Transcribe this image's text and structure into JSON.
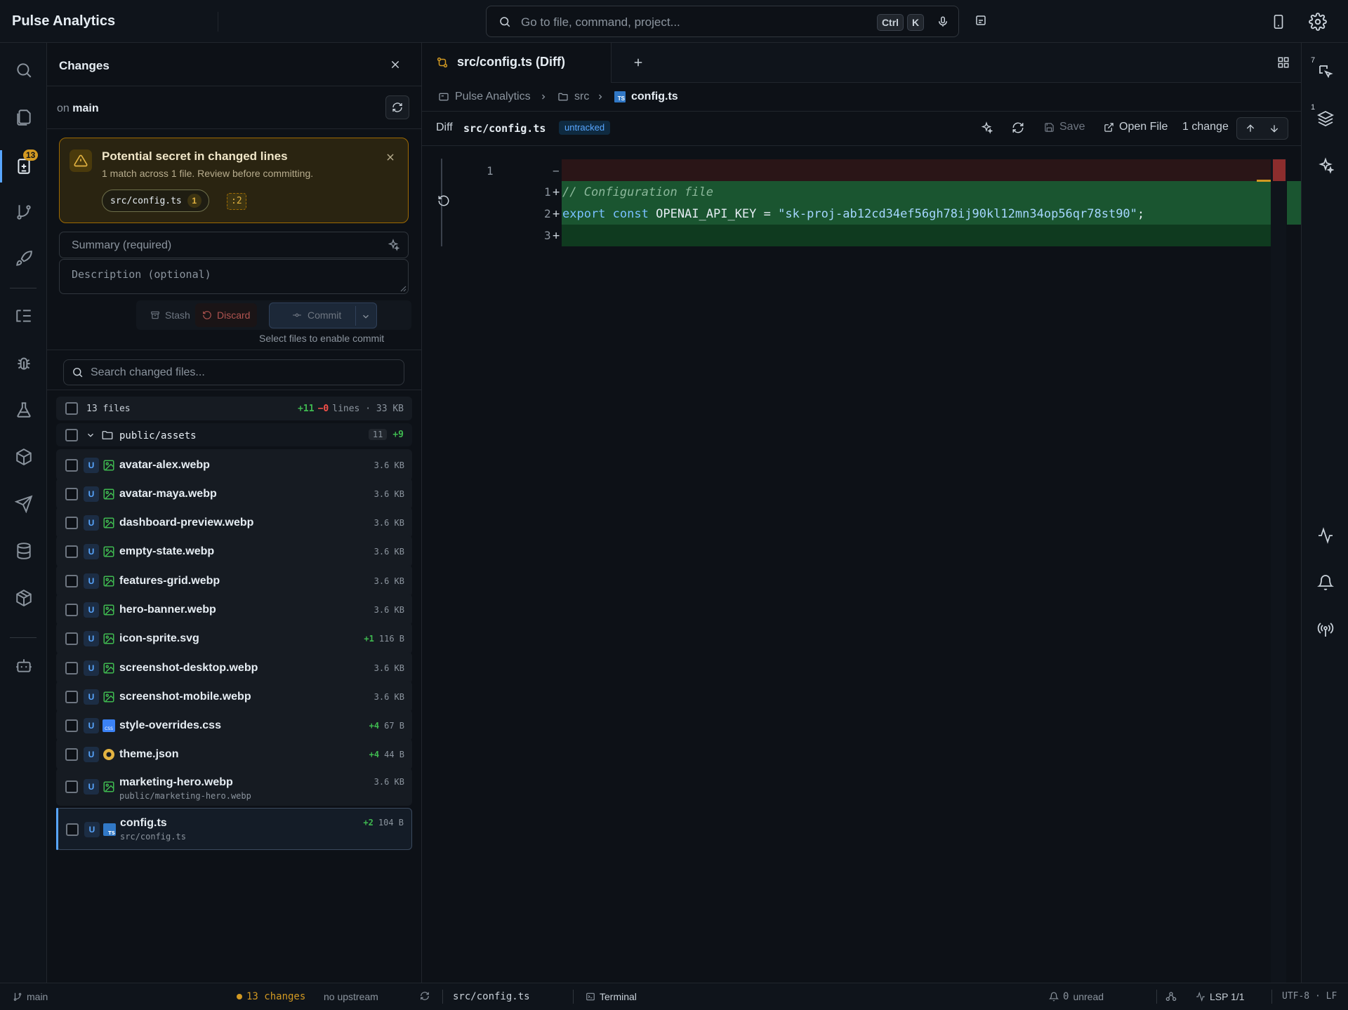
{
  "app": {
    "title": "Pulse Analytics"
  },
  "command_palette": {
    "placeholder": "Go to file, command, project...",
    "key1": "Ctrl",
    "key2": "K"
  },
  "left_rail": {
    "changes_badge": "13"
  },
  "changes_panel": {
    "title": "Changes",
    "branch_prefix": "on",
    "branch": "main",
    "warning": {
      "title": "Potential secret in changed lines",
      "subtitle": "1 match across 1 file. Review before committing.",
      "file": "src/config.ts",
      "count": "1",
      "line": ":2"
    },
    "summary_placeholder": "Summary (required)",
    "description_placeholder": "Description (optional)",
    "stash_label": "Stash",
    "discard_label": "Discard",
    "commit_label": "Commit",
    "commit_hint": "Select files to enable commit",
    "search_placeholder": "Search changed files...",
    "list_header": {
      "files": "13 files",
      "added": "+11",
      "removed": "−0",
      "rest": "lines · 33 KB"
    },
    "folder": {
      "name": "public/assets",
      "count": "11",
      "added": "+9"
    },
    "files": [
      {
        "status": "U",
        "type": "image",
        "name": "avatar-alex.webp",
        "added": "",
        "size": "3.6 KB"
      },
      {
        "status": "U",
        "type": "image",
        "name": "avatar-maya.webp",
        "added": "",
        "size": "3.6 KB"
      },
      {
        "status": "U",
        "type": "image",
        "name": "dashboard-preview.webp",
        "added": "",
        "size": "3.6 KB"
      },
      {
        "status": "U",
        "type": "image",
        "name": "empty-state.webp",
        "added": "",
        "size": "3.6 KB"
      },
      {
        "status": "U",
        "type": "image",
        "name": "features-grid.webp",
        "added": "",
        "size": "3.6 KB"
      },
      {
        "status": "U",
        "type": "image",
        "name": "hero-banner.webp",
        "added": "",
        "size": "3.6 KB"
      },
      {
        "status": "U",
        "type": "image",
        "name": "icon-sprite.svg",
        "added": "+1",
        "size": "116 B"
      },
      {
        "status": "U",
        "type": "image",
        "name": "screenshot-desktop.webp",
        "added": "",
        "size": "3.6 KB"
      },
      {
        "status": "U",
        "type": "image",
        "name": "screenshot-mobile.webp",
        "added": "",
        "size": "3.6 KB"
      },
      {
        "status": "U",
        "type": "css",
        "name": "style-overrides.css",
        "added": "+4",
        "size": "67 B"
      },
      {
        "status": "U",
        "type": "json",
        "name": "theme.json",
        "added": "+4",
        "size": "44 B"
      },
      {
        "status": "U",
        "type": "image",
        "name": "marketing-hero.webp",
        "path": "public/marketing-hero.webp",
        "added": "",
        "size": "3.6 KB"
      },
      {
        "status": "U",
        "type": "ts",
        "name": "config.ts",
        "path": "src/config.ts",
        "added": "+2",
        "size": "104 B"
      }
    ]
  },
  "editor": {
    "tab_label": "src/config.ts (Diff)",
    "breadcrumbs": [
      "Pulse Analytics",
      "src",
      "config.ts"
    ],
    "diff_label": "Diff",
    "diff_path": "src/config.ts",
    "diff_status": "untracked",
    "save_label": "Save",
    "open_file_label": "Open File",
    "change_count": "1 change",
    "old_line_number": "1",
    "removed_marker": "−",
    "lines": [
      {
        "num": "1",
        "sign": "+",
        "text": "// Configuration file",
        "kind": "comment"
      },
      {
        "num": "2",
        "sign": "+",
        "kw1": "export",
        "kw2": "const",
        "ident": "OPENAI_API_KEY",
        "eq": "=",
        "str": "\"sk-proj-ab12cd34ef56gh78ij90kl12mn34op56qr78st90\"",
        "semi": ";",
        "kind": "code"
      },
      {
        "num": "3",
        "sign": "+",
        "text": "",
        "kind": "empty"
      }
    ]
  },
  "right_rail": {
    "badge_top": "7",
    "badge_layers": "1"
  },
  "status_bar": {
    "branch": "main",
    "changes": "13 changes",
    "upstream": "no upstream",
    "file": "src/config.ts",
    "terminal": "Terminal",
    "unread_count": "0",
    "unread_label": "unread",
    "lsp": "LSP 1/1",
    "encoding": "UTF-8 · LF"
  },
  "colors": {
    "accent": "#58a6ff",
    "warning": "#d29922",
    "added": "#3fb950",
    "removed": "#f85149"
  }
}
